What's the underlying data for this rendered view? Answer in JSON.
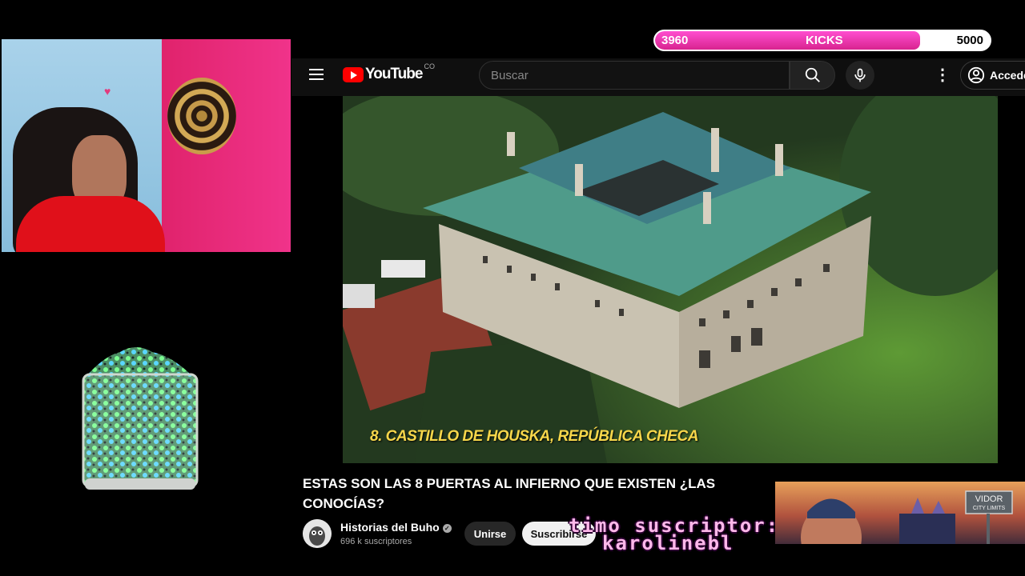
{
  "kicks": {
    "current": "3960",
    "label": "KICKS",
    "goal": "5000",
    "progress": 0.792
  },
  "youtube": {
    "logo_text": "YouTube",
    "country_code": "CO",
    "search_placeholder": "Buscar",
    "signin_label": "Acceder"
  },
  "video": {
    "caption": "8. CASTILLO DE HOUSKA, REPÚBLICA CHECA",
    "title": "ESTAS SON LAS 8 PUERTAS AL INFIERNO QUE EXISTEN ¿LAS CONOCÍAS?",
    "channel_name": "Historias del Buho",
    "subscribers": "696 k suscriptores",
    "join_label": "Unirse",
    "subscribe_label": "Suscribirse"
  },
  "overlay": {
    "ticker_line1": "timo suscriptor:",
    "ticker_line2": "karolinebl"
  },
  "ad": {
    "sign_line1": "VIDOR",
    "sign_line2": "CITY LIMITS"
  },
  "colors": {
    "kicks_fill": "#e0279a",
    "youtube_red": "#ff0000",
    "caption": "#f6d64a",
    "ticker": "#ffb8ea"
  }
}
